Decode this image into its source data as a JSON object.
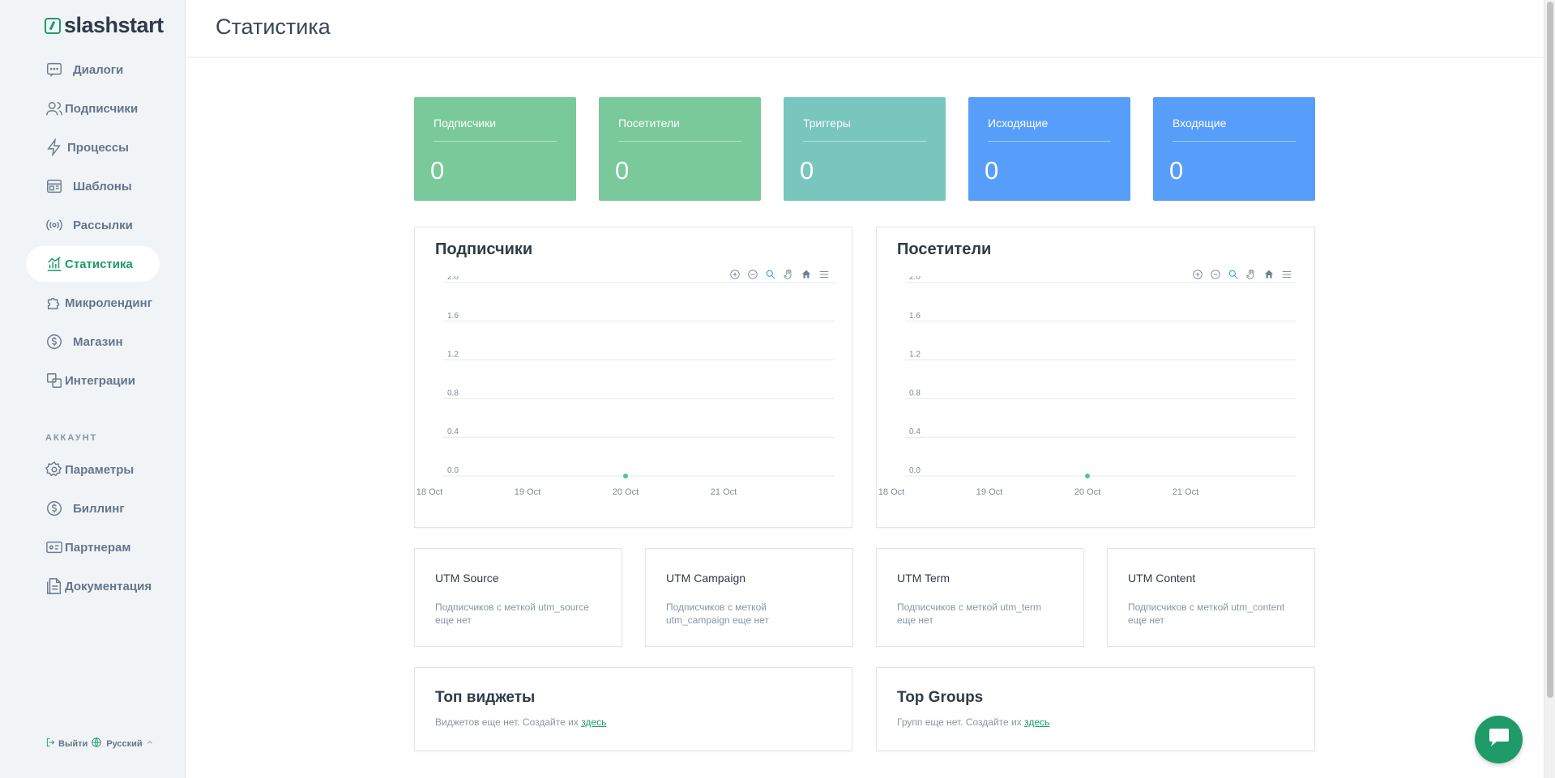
{
  "brand": {
    "name": "slashstart"
  },
  "sidebar": {
    "items": [
      {
        "label": "Диалоги",
        "icon": "chat-icon"
      },
      {
        "label": "Подписчики",
        "icon": "users-icon"
      },
      {
        "label": "Процессы",
        "icon": "bolt-icon"
      },
      {
        "label": "Шаблоны",
        "icon": "template-icon"
      },
      {
        "label": "Рассылки",
        "icon": "broadcast-icon"
      },
      {
        "label": "Статистика",
        "icon": "chart-icon",
        "active": true
      },
      {
        "label": "Микролендинг",
        "icon": "puzzle-icon"
      },
      {
        "label": "Магазин",
        "icon": "dollar-icon"
      },
      {
        "label": "Интеграции",
        "icon": "integration-icon"
      }
    ],
    "section_title": "АККАУНТ",
    "account_items": [
      {
        "label": "Параметры",
        "icon": "gear-icon"
      },
      {
        "label": "Биллинг",
        "icon": "dollar-icon"
      },
      {
        "label": "Партнерам",
        "icon": "partner-icon"
      },
      {
        "label": "Документация",
        "icon": "document-icon"
      }
    ],
    "footer": {
      "logout": "Выйти",
      "language": "Русский"
    }
  },
  "header": {
    "title": "Статистика"
  },
  "stats": [
    {
      "title": "Подписчики",
      "value": "0",
      "color": "#79c99a"
    },
    {
      "title": "Посетители",
      "value": "0",
      "color": "#79c99a"
    },
    {
      "title": "Триггеры",
      "value": "0",
      "color": "#78c6bd"
    },
    {
      "title": "Исходящие",
      "value": "0",
      "color": "#579efa"
    },
    {
      "title": "Входящие",
      "value": "0",
      "color": "#579efa"
    }
  ],
  "charts": {
    "subscribers_title": "Подписчики",
    "visitors_title": "Посетители"
  },
  "chart_data": [
    {
      "type": "line",
      "title": "Подписчики",
      "x": [
        "20 Oct"
      ],
      "series": [
        {
          "values": [
            0
          ]
        }
      ],
      "x_ticks": [
        "18 Oct",
        "19 Oct",
        "20 Oct",
        "21 Oct"
      ],
      "y_ticks": [
        "2.0",
        "1.6",
        "1.2",
        "0.8",
        "0.4",
        "0.0"
      ],
      "ylim": [
        0,
        2
      ],
      "grid": true,
      "color": "#4fc3a1"
    },
    {
      "type": "line",
      "title": "Посетители",
      "x": [
        "20 Oct"
      ],
      "series": [
        {
          "values": [
            0
          ]
        }
      ],
      "x_ticks": [
        "18 Oct",
        "19 Oct",
        "20 Oct",
        "21 Oct"
      ],
      "y_ticks": [
        "2.0",
        "1.6",
        "1.2",
        "0.8",
        "0.4",
        "0.0"
      ],
      "ylim": [
        0,
        2
      ],
      "grid": true,
      "color": "#4fc3a1"
    }
  ],
  "utm": [
    {
      "title": "UTM Source",
      "desc": "Подписчиков с меткой utm_source еще нет"
    },
    {
      "title": "UTM Campaign",
      "desc": "Подписчиков с меткой utm_campaign еще нет"
    },
    {
      "title": "UTM Term",
      "desc": "Подписчиков с меткой utm_term еще нет"
    },
    {
      "title": "UTM Content",
      "desc": "Подписчиков с меткой utm_content еще нет"
    }
  ],
  "widgets": {
    "title": "Топ виджеты",
    "desc": "Виджетов еще нет. Создайте их",
    "link": "здесь"
  },
  "groups": {
    "title": "Top Groups",
    "desc": "Групп еще нет. Создайте их",
    "link": "здесь"
  }
}
